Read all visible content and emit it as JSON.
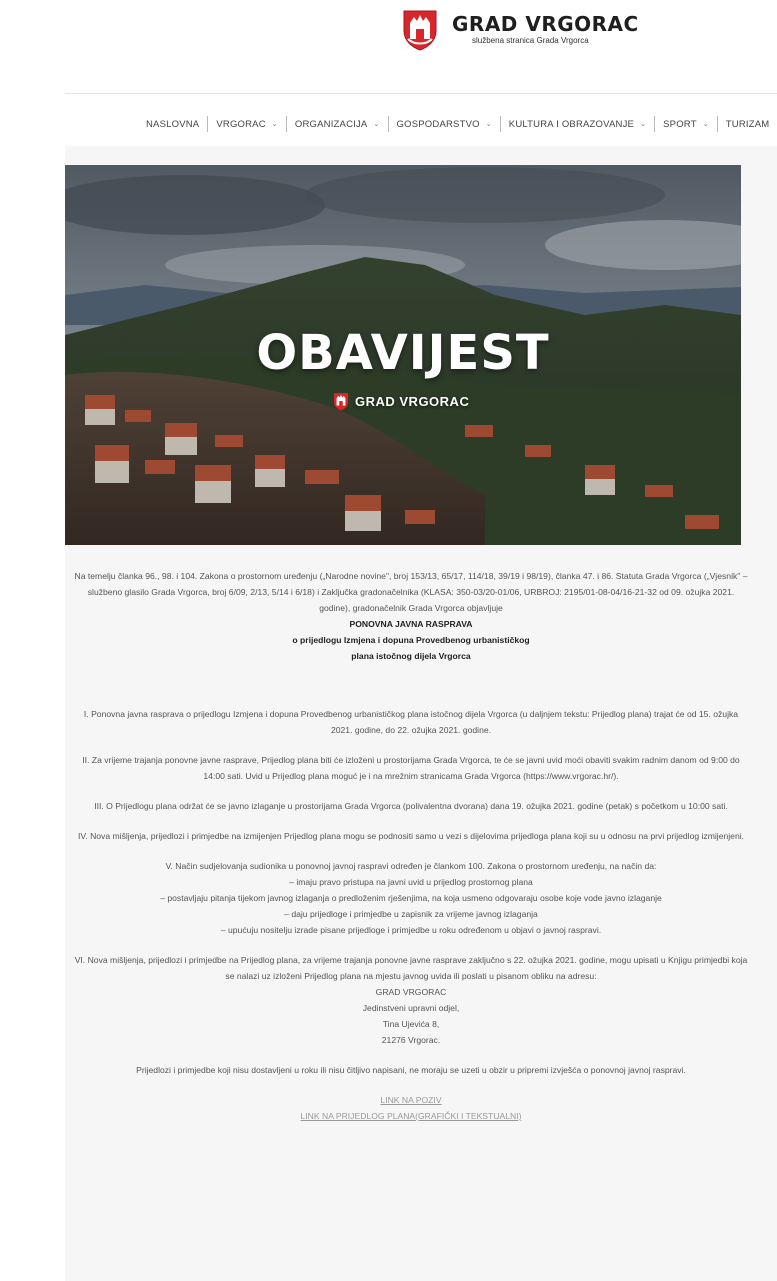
{
  "header": {
    "brand_title": "GRAD VRGORAC",
    "brand_subtitle": "službena stranica Grada Vrgorca"
  },
  "nav": {
    "items": [
      {
        "label": "NASLOVNA",
        "has_dropdown": false
      },
      {
        "label": "VRGORAC",
        "has_dropdown": true
      },
      {
        "label": "ORGANIZACIJA",
        "has_dropdown": true
      },
      {
        "label": "GOSPODARSTVO",
        "has_dropdown": true
      },
      {
        "label": "KULTURA I OBRAZOVANJE",
        "has_dropdown": true
      },
      {
        "label": "SPORT",
        "has_dropdown": true
      },
      {
        "label": "TURIZAM",
        "has_dropdown": false
      }
    ],
    "chevron": "⌄"
  },
  "hero": {
    "title": "OBAVIJEST",
    "brand": "GRAD VRGORAC"
  },
  "article": {
    "intro_1": "Na temelju članka 96., 98. i 104. Zakona o prostornom uređenju („Narodne novine\", broj 153/13, 65/17, 114/18, 39/19 i 98/19), članka 47. i 86. Statuta Grada Vrgorca („Vjesnik\" – službeno glasilo Grada Vrgorca, broj 6/09, 2/13, 5/14 i 6/18) i Zaključka gradonačelnika (KLASA: 350-03/20-01/06, URBROJ: 2195/01-08-04/16-21-32 od 09. ožujka 2021. godine), gradonačelnik Grada Vrgorca objavljuje",
    "heading_1": "PONOVNA JAVNA RASPRAVA",
    "heading_2": "o prijedlogu Izmjena i dopuna Provedbenog urbanističkog",
    "heading_3": "plana istočnog dijela Vrgorca",
    "p1": "I. Ponovna javna rasprava o prijedlogu Izmjena i dopuna Provedbenog urbanističkog plana istočnog dijela Vrgorca (u daljnjem tekstu: Prijedlog plana) trajat će od 15. ožujka 2021. godine, do 22. ožujka 2021. godine.",
    "p2": "II. Za vrijeme trajanja ponovne javne rasprave, Prijedlog plana biti će izloženi u prostorijama Grada Vrgorca, te će se javni uvid moći obaviti svakim radnim danom od 9:00 do 14:00 sati. Uvid u Prijedlog plana moguć je i na mrežnim stranicama Grada Vrgorca (https://www.vrgorac.hr/).",
    "p3": "III. O Prijedlogu plana održat će se javno izlaganje u prostorijama Grada Vrgorca (polivalentna dvorana) dana 19. ožujka 2021. godine (petak) s početkom u 10:00 sati.",
    "p4": "IV. Nova mišljenja, prijedlozi i primjedbe na izmijenjen Prijedlog plana mogu se podnositi samo u vezi s dijelovima prijedloga plana koji su u odnosu na prvi prijedlog izmijenjeni.",
    "p5_intro": "V. Način sudjelovanja sudionika u ponovnoj javnoj raspravi određen je člankom 100. Zakona o prostornom uređenju, na način da:",
    "p5_items": [
      "– imaju pravo pristupa na javni uvid u prijedlog prostornog plana",
      "– postavljaju pitanja tijekom javnog izlaganja o predloženim rješenjima, na koja usmeno odgovaraju osobe koje vode javno izlaganje",
      "– daju prijedloge i primjedbe u zapisnik za vrijeme javnog izlaganja",
      "– upućuju nositelju izrade pisane prijedloge i primjedbe u roku određenom u objavi o javnoj raspravi."
    ],
    "p6": "VI. Nova mišljenja, prijedlozi i primjedbe na Prijedlog plana, za vrijeme trajanja ponovne javne rasprave zaključno s 22. ožujka 2021. godine, mogu upisati u Knjigu primjedbi koja se nalazi uz izloženi Prijedlog plana na mjestu javnog uvida ili poslati u pisanom obliku na adresu:",
    "address": [
      "GRAD VRGORAC",
      "Jedinstveni upravni odjel,",
      "Tina Ujevića 8,",
      "21276 Vrgorac."
    ],
    "p7": "Prijedlozi i primjedbe koji nisu dostavljeni u roku ili nisu čitljivo napisani, ne moraju se uzeti u obzir u pripremi izvješća o ponovnoj javnoj raspravi.",
    "link_1": "LINK NA POZIV",
    "link_2": "LINK NA PRIJEDLOG PLANA(GRAFIČKI I TEKSTUALNI)"
  }
}
